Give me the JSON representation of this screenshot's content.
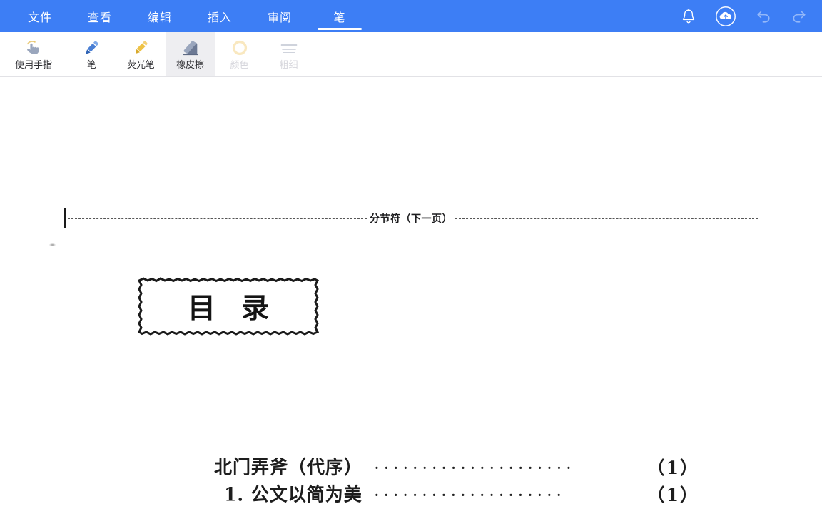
{
  "app": {
    "accent_color": "#3d7ef5",
    "selected_tool_bg": "#eeeef1",
    "document_bg": "#ffffff"
  },
  "menubar": {
    "tabs": [
      {
        "label": "文件",
        "name": "tab-file",
        "active": false
      },
      {
        "label": "查看",
        "name": "tab-view",
        "active": false
      },
      {
        "label": "编辑",
        "name": "tab-edit",
        "active": false
      },
      {
        "label": "插入",
        "name": "tab-insert",
        "active": false
      },
      {
        "label": "审阅",
        "name": "tab-review",
        "active": false
      },
      {
        "label": "笔",
        "name": "tab-pen",
        "active": true
      }
    ],
    "actions": [
      {
        "icon": "bell-icon",
        "label": "通知",
        "disabled": false
      },
      {
        "icon": "cloud-upload-icon",
        "label": "上传",
        "disabled": false
      },
      {
        "icon": "undo-icon",
        "label": "撤销",
        "disabled": true
      },
      {
        "icon": "redo-icon",
        "label": "恢复",
        "disabled": true
      }
    ]
  },
  "toolbar": {
    "tools": [
      {
        "label": "使用手指",
        "icon": "finger-touch-icon",
        "selected": false,
        "disabled": false
      },
      {
        "label": "笔",
        "icon": "pen-icon",
        "selected": false,
        "disabled": false
      },
      {
        "label": "荧光笔",
        "icon": "highlighter-icon",
        "selected": false,
        "disabled": false
      },
      {
        "label": "橡皮擦",
        "icon": "eraser-icon",
        "selected": true,
        "disabled": false
      },
      {
        "label": "颜色",
        "icon": "color-ring-icon",
        "selected": false,
        "disabled": true
      },
      {
        "label": "粗细",
        "icon": "thickness-lines-icon",
        "selected": false,
        "disabled": true
      }
    ]
  },
  "document": {
    "section_break_label": "分节符（下一页）",
    "title_box": {
      "text": "目录"
    },
    "toc": [
      {
        "entry": "北门弄斧（代序）",
        "leader": "·····················",
        "page": "（1）",
        "indent": false
      },
      {
        "entry": "1. 公文以简为美",
        "leader": "····················",
        "page": "（1）",
        "indent": true
      }
    ]
  }
}
